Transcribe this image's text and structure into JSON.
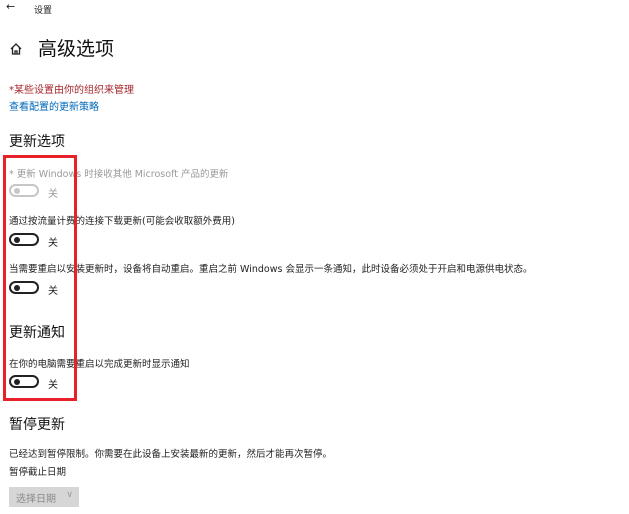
{
  "window": {
    "back_glyph": "←",
    "app_title": "设置"
  },
  "header": {
    "title": "高级选项"
  },
  "notice": {
    "managed_text": "*某些设置由你的组织来管理",
    "policy_link": "查看配置的更新策略"
  },
  "update_options": {
    "heading": "更新选项",
    "options": [
      {
        "text": "* 更新 Windows 时接收其他 Microsoft 产品的更新",
        "toggle_label": "关",
        "enabled": false,
        "state": "off"
      },
      {
        "text": "通过按流量计费的连接下载更新(可能会收取额外费用)",
        "toggle_label": "关",
        "enabled": true,
        "state": "off"
      },
      {
        "text": "当需要重启以安装更新时，设备将自动重启。重启之前 Windows 会显示一条通知，此时设备必须处于开启和电源供电状态。",
        "toggle_label": "关",
        "enabled": true,
        "state": "off"
      }
    ]
  },
  "update_notifications": {
    "heading": "更新通知",
    "option": {
      "text": "在你的电脑需要重启以完成更新时显示通知",
      "toggle_label": "关",
      "state": "off"
    }
  },
  "pause_updates": {
    "heading": "暂停更新",
    "description": "已经达到暂停限制。你需要在此设备上安装最新的更新，然后才能再次暂停。",
    "date_label": "暂停截止日期",
    "date_select": "选择日期"
  },
  "colors": {
    "accent_link": "#0067b8",
    "warning_text": "#a4262c",
    "highlight_box": "#e8202a"
  }
}
